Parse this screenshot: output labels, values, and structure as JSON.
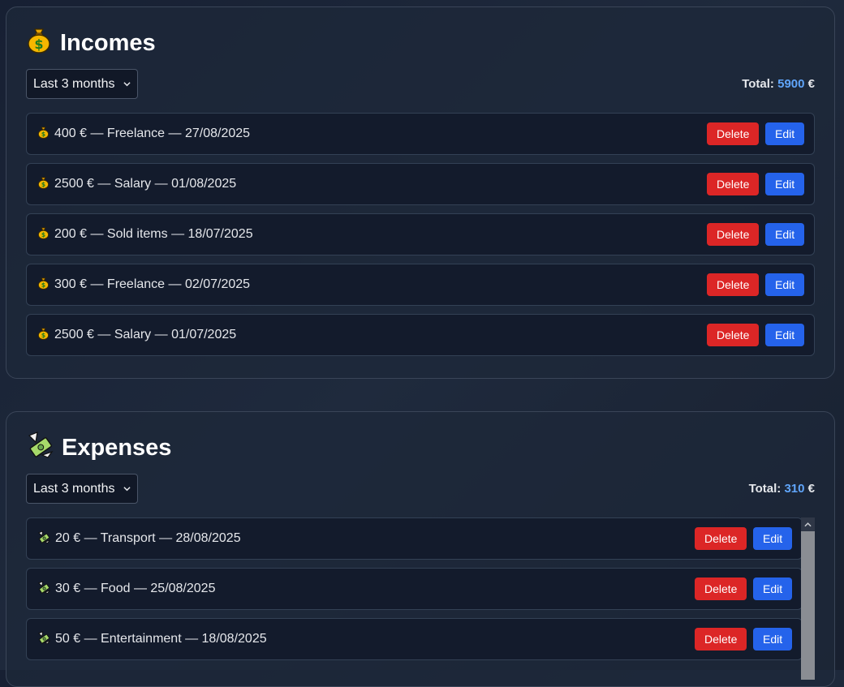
{
  "incomes": {
    "title": "Incomes",
    "icon": "money-bag-icon",
    "period": "Last 3 months",
    "total_label": "Total:",
    "total_value": "5900",
    "total_currency": "€",
    "items": [
      {
        "text": "400 € — Freelance — 27/08/2025"
      },
      {
        "text": "2500 € — Salary — 01/08/2025"
      },
      {
        "text": "200 € — Sold items — 18/07/2025"
      },
      {
        "text": "300 € — Freelance — 02/07/2025"
      },
      {
        "text": "2500 € — Salary — 01/07/2025"
      }
    ]
  },
  "expenses": {
    "title": "Expenses",
    "icon": "money-with-wings-icon",
    "period": "Last 3 months",
    "total_label": "Total:",
    "total_value": "310",
    "total_currency": "€",
    "items": [
      {
        "text": "20 € — Transport — 28/08/2025"
      },
      {
        "text": "30 € — Food — 25/08/2025"
      },
      {
        "text": "50 € — Entertainment — 18/08/2025"
      }
    ]
  },
  "buttons": {
    "delete": "Delete",
    "edit": "Edit"
  },
  "colors": {
    "delete": "#dc2626",
    "edit": "#2563eb",
    "total_accent": "#60a5fa"
  }
}
